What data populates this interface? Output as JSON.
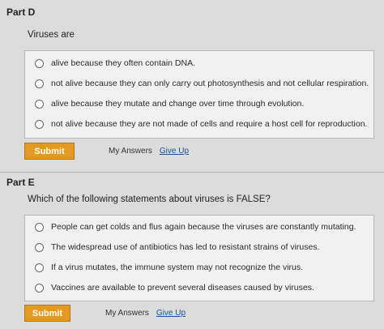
{
  "partD": {
    "label": "Part D",
    "prompt": "Viruses are",
    "options": [
      "alive because they often contain DNA.",
      "not alive because they can only carry out photosynthesis and not cellular respiration.",
      "alive because they mutate and change over time through evolution.",
      "not alive because they are not made of cells and require a host cell for reproduction."
    ],
    "submit_label": "Submit",
    "my_answers_label": "My Answers",
    "give_up_label": "Give Up"
  },
  "partE": {
    "label": "Part E",
    "prompt": "Which of the following statements about viruses is FALSE?",
    "options": [
      "People can get colds and flus again because the viruses are constantly mutating.",
      "The widespread use of antibiotics has led to resistant strains of viruses.",
      "If a virus mutates, the immune system may not recognize the virus.",
      "Vaccines are available to prevent several diseases caused by viruses."
    ],
    "submit_label": "Submit",
    "my_answers_label": "My Answers",
    "give_up_label": "Give Up"
  },
  "colors": {
    "submit": "#e39a1e",
    "link": "#1a4f9a",
    "background": "#dcdcdc"
  }
}
